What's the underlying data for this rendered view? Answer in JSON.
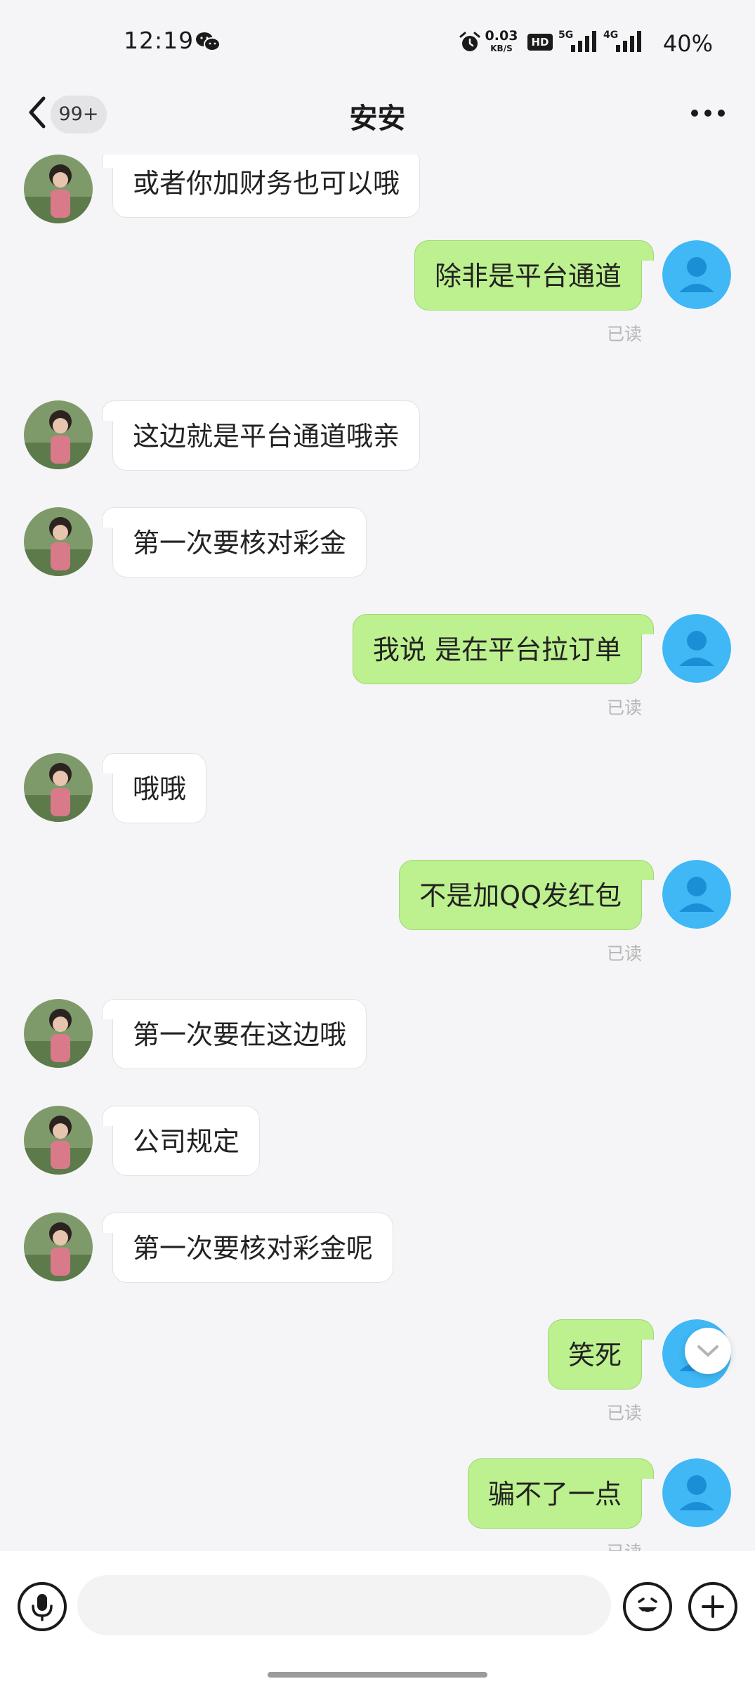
{
  "status_bar": {
    "time": "12:19",
    "net_speed_value": "0.03",
    "net_speed_unit": "KB/S",
    "hd_label": "HD",
    "signal_1_label": "5G",
    "signal_2_label": "4G",
    "battery": "40%"
  },
  "header": {
    "unread_badge": "99+",
    "title": "安安"
  },
  "messages": [
    {
      "from": "other",
      "text": "或者你加财务也可以哦"
    },
    {
      "from": "self",
      "text": "除非是平台通道",
      "status": "已读"
    },
    {
      "from": "other",
      "text": "这边就是平台通道哦亲"
    },
    {
      "from": "other",
      "text": "第一次要核对彩金"
    },
    {
      "from": "self",
      "text": "我说 是在平台拉订单",
      "status": "已读"
    },
    {
      "from": "other",
      "text": "哦哦"
    },
    {
      "from": "self",
      "text": "不是加QQ发红包",
      "status": "已读"
    },
    {
      "from": "other",
      "text": "第一次要在这边哦"
    },
    {
      "from": "other",
      "text": "公司规定"
    },
    {
      "from": "other",
      "text": "第一次要核对彩金呢"
    },
    {
      "from": "self",
      "text": "笑死",
      "status": "已读"
    },
    {
      "from": "self",
      "text": "骗不了一点",
      "status": "已读"
    }
  ],
  "input": {
    "value": "",
    "placeholder": ""
  },
  "colors": {
    "outgoing_bubble": "#bdf08e",
    "incoming_bubble": "#ffffff",
    "self_avatar": "#3fb8f5",
    "background": "#f5f5f7"
  }
}
